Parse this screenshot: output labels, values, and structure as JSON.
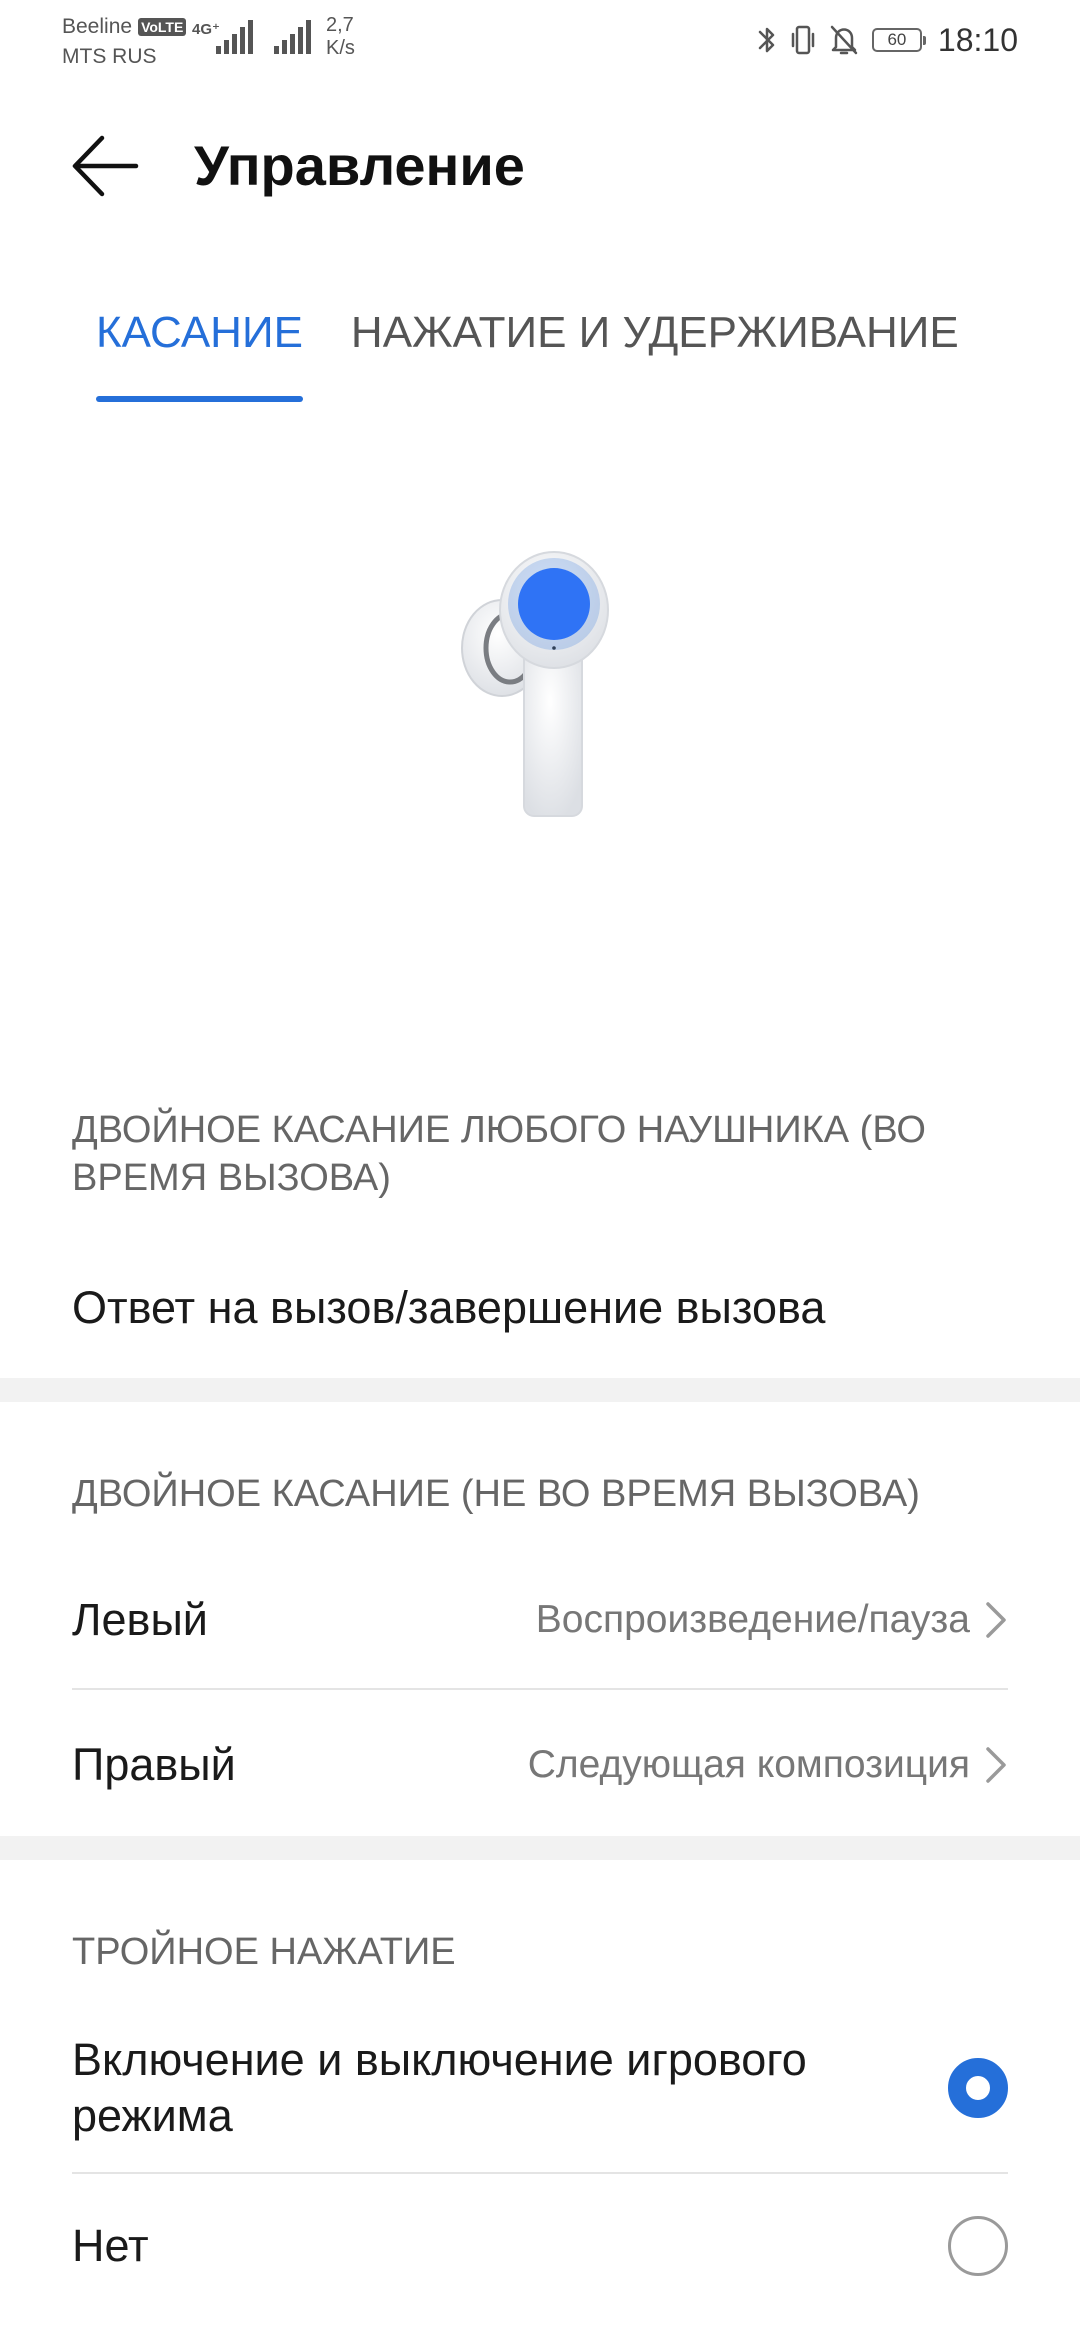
{
  "status_bar": {
    "carrier_1": "Beeline",
    "volte": "VoLTE",
    "carrier_2": "MTS RUS",
    "network_type": "4G⁺",
    "speed_value": "2,7",
    "speed_unit": "K/s",
    "battery": "60",
    "time": "18:10",
    "icons": [
      "bluetooth-icon",
      "vibrate-icon",
      "bell-off-icon",
      "battery-icon"
    ]
  },
  "header": {
    "title": "Управление",
    "back_icon": "arrow-left-icon"
  },
  "tabs": [
    {
      "label": "КАСАНИЕ",
      "active": true
    },
    {
      "label": "НАЖАТИЕ И УДЕРЖИВАНИЕ",
      "active": false
    }
  ],
  "sections": {
    "call_double_tap": {
      "header": "ДВОЙНОЕ КАСАНИЕ ЛЮБОГО НАУШНИКА (ВО ВРЕМЯ ВЫЗОВА)",
      "item": "Ответ на вызов/завершение вызова"
    },
    "double_tap": {
      "header": "ДВОЙНОЕ КАСАНИЕ (НЕ ВО ВРЕМЯ ВЫЗОВА)",
      "items": [
        {
          "label": "Левый",
          "value": "Воспроизведение/пауза"
        },
        {
          "label": "Правый",
          "value": "Следующая композиция"
        }
      ]
    },
    "triple_press": {
      "header": "ТРОЙНОЕ НАЖАТИЕ",
      "options": [
        {
          "label": "Включение и выключение игрового режима",
          "selected": true
        },
        {
          "label": "Нет",
          "selected": false
        }
      ]
    }
  },
  "colors": {
    "accent": "#256fd9",
    "text_primary": "#1a1a1a",
    "text_secondary": "#666666",
    "divider": "#e4e4e4",
    "section_band": "#f2f2f2"
  }
}
